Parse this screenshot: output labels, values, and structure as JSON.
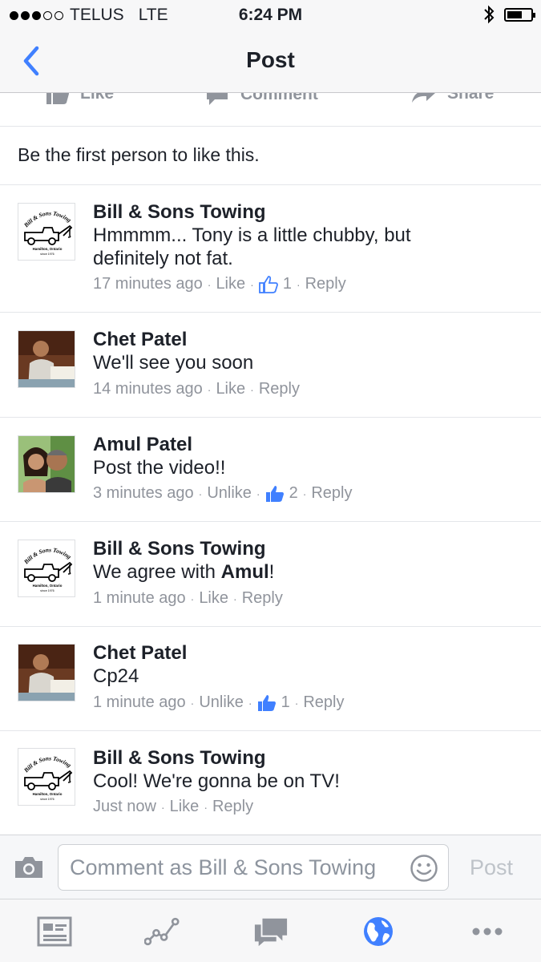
{
  "status": {
    "carrier": "TELUS",
    "network": "LTE",
    "time": "6:24 PM",
    "signal_bars": 3,
    "signal_total": 5
  },
  "nav": {
    "title": "Post",
    "back_icon": "chevron-left-icon"
  },
  "actions": {
    "like": "Like",
    "comment": "Comment",
    "share": "Share"
  },
  "likes_summary": "Be the first person to like this.",
  "comments": [
    {
      "author": "Bill & Sons Towing",
      "text_lines": [
        "Hmmmm... Tony is a little chubby, but",
        "definitely not fat."
      ],
      "time": "17 minutes ago",
      "like_action": "Like",
      "like_count": "1",
      "reply": "Reply"
    },
    {
      "author": "Chet Patel",
      "text_lines": [
        "We'll see you soon"
      ],
      "time": "14 minutes ago",
      "like_action": "Like",
      "reply": "Reply"
    },
    {
      "author": "Amul Patel",
      "text_lines": [
        "Post the video!!"
      ],
      "time": "3 minutes ago",
      "like_action": "Unlike",
      "like_count": "2",
      "reply": "Reply"
    },
    {
      "author": "Bill & Sons Towing",
      "text_prefix": "We agree with ",
      "text_mention": "Amul",
      "text_suffix": "!",
      "time": "1 minute ago",
      "like_action": "Like",
      "reply": "Reply"
    },
    {
      "author": "Chet Patel",
      "text_lines": [
        "Cp24"
      ],
      "time": "1 minute ago",
      "like_action": "Unlike",
      "like_count": "1",
      "reply": "Reply"
    },
    {
      "author": "Bill & Sons Towing",
      "text_lines": [
        "Cool! We're gonna be on TV!"
      ],
      "time": "Just now",
      "like_action": "Like",
      "reply": "Reply"
    }
  ],
  "logo": {
    "arc_text": "Bill & Sons Towing",
    "city": "Hamilton, Ontario",
    "since": "since 1976"
  },
  "composer": {
    "placeholder": "Comment as Bill & Sons Towing",
    "post_label": "Post"
  },
  "tabs": [
    "news-feed-icon",
    "activity-icon",
    "messages-icon",
    "globe-icon",
    "more-icon"
  ],
  "colors": {
    "accent": "#4080ff",
    "meta": "#90949c",
    "text": "#1d2129"
  }
}
